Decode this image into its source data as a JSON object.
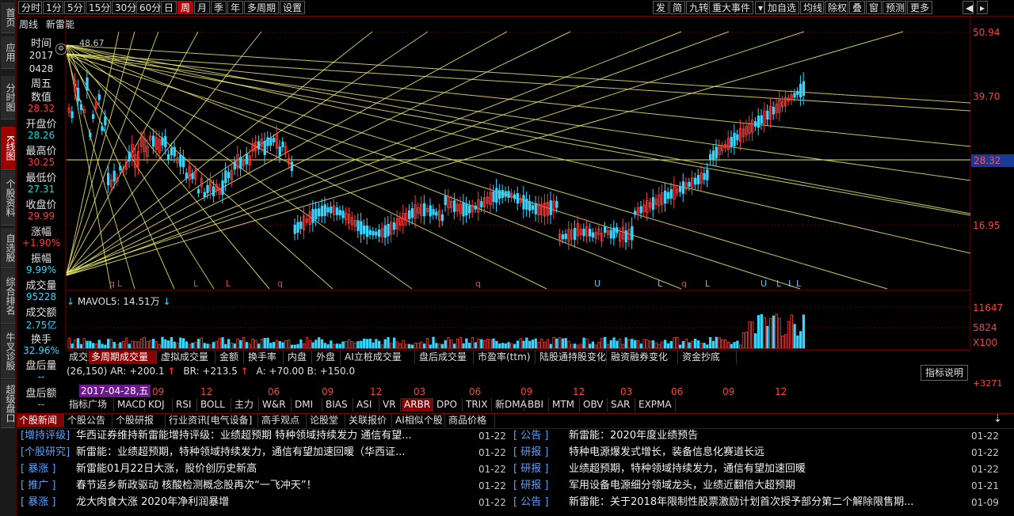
{
  "left_nav": [
    "首页",
    "应用",
    "分时图",
    "K线图",
    "个股资料",
    "自选股",
    "综合排名",
    "牛叉诊股",
    "超级盘口"
  ],
  "toolbar": {
    "periods": [
      "分时",
      "1分",
      "5分",
      "15分",
      "30分",
      "60分",
      "日",
      "周",
      "月",
      "季",
      "年",
      "多周期",
      "设置"
    ],
    "active_period": "周",
    "right_tools": [
      "发",
      "简",
      "九转",
      "重大事件",
      "加自选",
      "均线",
      "除权",
      "叠",
      "窗",
      "预测",
      "更多"
    ]
  },
  "header": {
    "period_label": "周线",
    "stock_name": "新雷能",
    "high_marker": "48.67"
  },
  "info_panel": {
    "time_label": "时间",
    "year": "2017",
    "date": "0428",
    "weekday": "周五",
    "value_label": "数值",
    "value": "28.32",
    "open_label": "开盘价",
    "open": "28.26",
    "high_label": "最高价",
    "high": "30.25",
    "low_label": "最低价",
    "low": "27.31",
    "close_label": "收盘价",
    "close": "29.99",
    "change_label": "涨幅",
    "change": "+1.90%",
    "amplitude_label": "振幅",
    "amplitude": "9.99%",
    "volume_label": "成交量",
    "volume": "95228",
    "amount_label": "成交额",
    "amount": "2.75亿",
    "turnover_label": "换手",
    "turnover": "32.96%",
    "after_vol_label": "盘后量",
    "after_vol": "--",
    "after_amt_label": "盘后额",
    "after_amt": "--"
  },
  "price_axis": {
    "labels": [
      "50.94",
      "39.70",
      "28.32",
      "16.95"
    ],
    "current": "28.32"
  },
  "markers": [
    "q",
    "L",
    "L",
    "L",
    "q",
    "q",
    "U",
    "L",
    "q",
    "L",
    "U",
    "L",
    "L",
    "L"
  ],
  "volume_panel": {
    "indicator": "MAVOL5: 14.51万",
    "axis_labels": [
      "11647",
      "5824",
      "X100"
    ]
  },
  "indicator_tabs": [
    "成交量",
    "多周期成交量",
    "虚拟成交量",
    "金额",
    "换手率",
    "内盘",
    "外盘",
    "AI立桩成交量",
    "盘后成交量",
    "市盈率(ttm)",
    "陆股通持股变化",
    "融资融券变化",
    "资金抄底"
  ],
  "active_indicator_tab": "多周期成交量",
  "arbr": {
    "params": "(26,150)",
    "ar": "AR: +200.1",
    "br": "BR: +213.5",
    "ab": "A: +70.00 B: +150.0",
    "explain_button": "指标说明",
    "axis_value": "+3271"
  },
  "time_axis": {
    "selected_date": "2017-04-28,五",
    "ticks": [
      "09",
      "12",
      "06",
      "09",
      "12",
      "03",
      "06",
      "09",
      "12",
      "03",
      "06",
      "09",
      "12"
    ]
  },
  "tech_tabs": [
    "指标广场",
    "MACD",
    "KDJ",
    "RSI",
    "BOLL",
    "主力",
    "W&R",
    "DMI",
    "BIAS",
    "ASI",
    "VR",
    "ARBR",
    "DPO",
    "TRIX",
    "新DMA",
    "BBI",
    "MTM",
    "OBV",
    "SAR",
    "EXPMA"
  ],
  "active_tech_tab": "ARBR",
  "news_tabs": [
    "个股新闻",
    "个股公告",
    "个股研报",
    "行业资讯[电气设备]",
    "高手观点",
    "论股堂",
    "关联报价",
    "AI相似个股",
    "商品价格"
  ],
  "active_news_tab": "个股新闻",
  "news_left": [
    {
      "tag": "[增持评级]",
      "title": "华西证券维持新雷能增持评级：业绩超预期 特种领域持续发力 通信有望...",
      "date": "01-22"
    },
    {
      "tag": "[个股研究]",
      "title": "新雷能：业绩超预期，特种领域持续发力，通信有望加速回暖（华西证...",
      "date": "01-22"
    },
    {
      "tag": "[  暴涨  ]",
      "title": "新雷能01月22日大涨，股价创历史新高",
      "date": "01-22"
    },
    {
      "tag": "[  推广  ]",
      "title": "春节返乡新政驱动 核酸检测概念股再次“一飞冲天”！",
      "date": "01-22"
    },
    {
      "tag": "[  暴涨  ]",
      "title": "龙大肉食大涨 2020年净利润暴增",
      "date": "01-22"
    }
  ],
  "news_right": [
    {
      "tag": "[  公告  ]",
      "title": "新雷能：2020年度业绩预告",
      "date": "01-22"
    },
    {
      "tag": "[  研报  ]",
      "title": "特种电源爆发式增长，装备信息化赛道长远",
      "date": "01-22"
    },
    {
      "tag": "[  研报  ]",
      "title": "业绩超预期，特种领域持续发力，通信有望加速回暖",
      "date": "01-22"
    },
    {
      "tag": "[  研报  ]",
      "title": "军用设备电源细分领域龙头，业绩近翻倍大超预期",
      "date": "01-21"
    },
    {
      "tag": "[  公告  ]",
      "title": "新雷能：关于2018年限制性股票激励计划首次授予部分第二个解除限售期...",
      "date": "01-09"
    }
  ],
  "colors": {
    "up": "#ff3b3b",
    "down": "#35d6ff",
    "gann": "#e8e86a",
    "accent": "#b80000"
  }
}
